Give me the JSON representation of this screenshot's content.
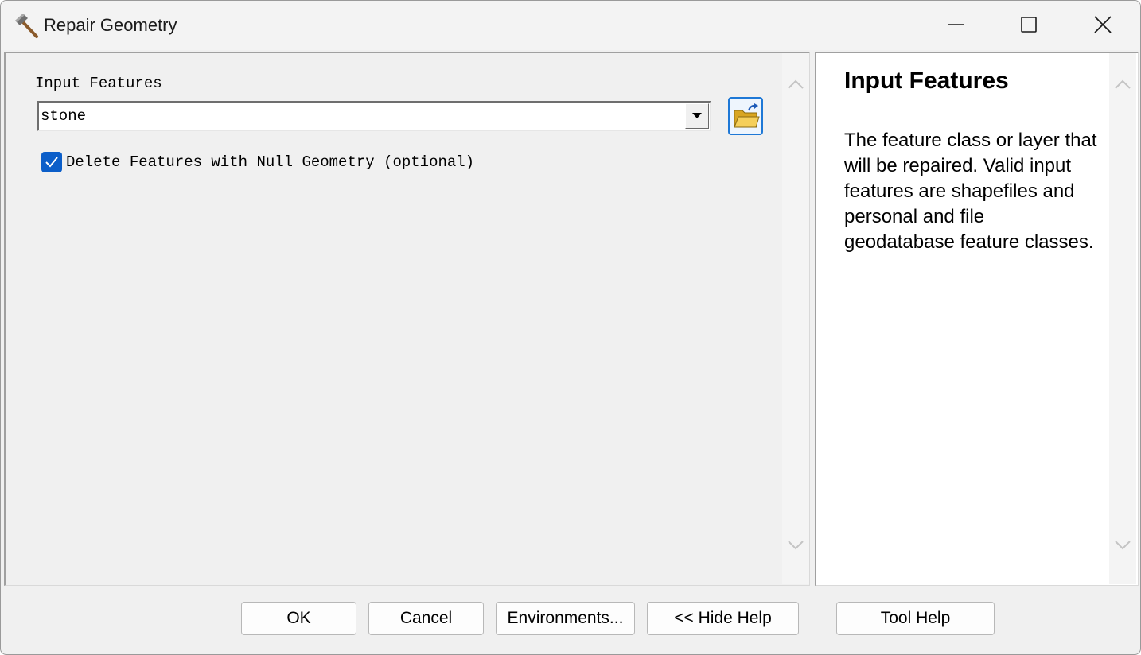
{
  "window": {
    "title": "Repair Geometry",
    "icon": "hammer-icon",
    "controls": [
      "minimize-icon",
      "maximize-icon",
      "close-icon"
    ]
  },
  "parameters": {
    "input_features_label": "Input Features",
    "input_features_value": "stone",
    "delete_null_label": "Delete Features with Null Geometry (optional)",
    "delete_null_checked": true
  },
  "help": {
    "title": "Input Features",
    "body": "The feature class or layer that will be repaired. Valid input features are shapefiles and personal and file geodatabase feature classes."
  },
  "buttons": {
    "ok": "OK",
    "cancel": "Cancel",
    "environments": "Environments...",
    "hide_help": "<< Hide Help",
    "tool_help": "Tool Help"
  },
  "colors": {
    "accent": "#0b5ec9",
    "focus_border": "#1e78d6",
    "dialog_bg": "#f0f0f0",
    "help_bg": "#ffffff"
  }
}
